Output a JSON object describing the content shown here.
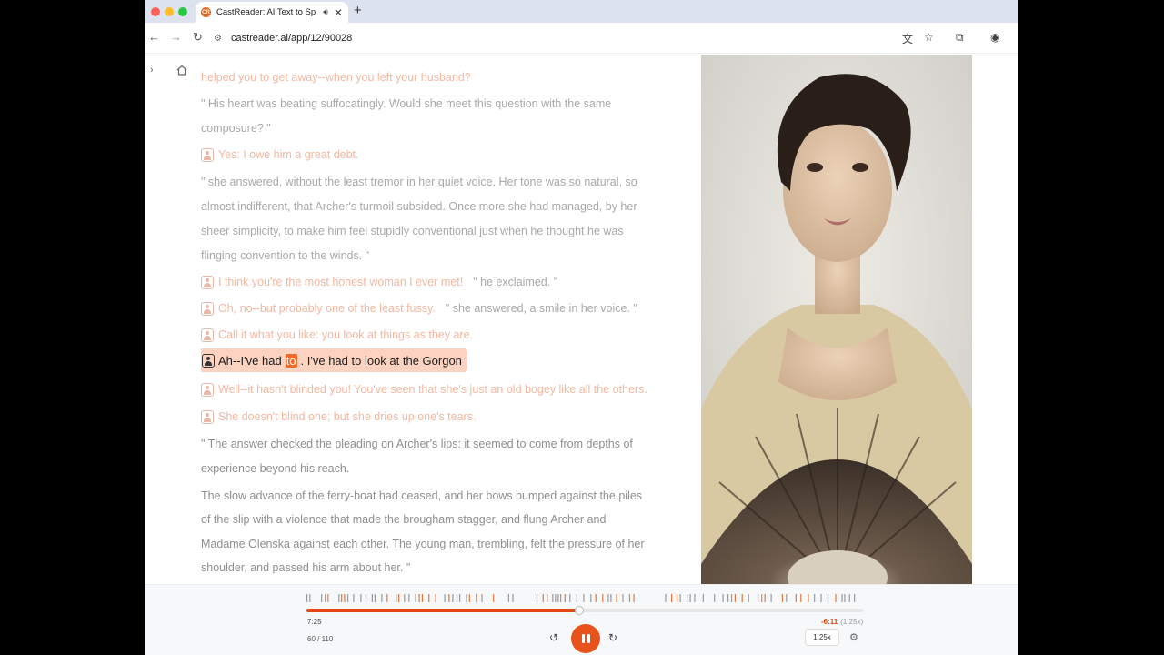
{
  "browser": {
    "tab_title": "CastReader: AI Text to Sp",
    "tab_favicon": "CR",
    "sound_icon": "speaker-icon",
    "close_glyph": "✕",
    "new_tab_glyph": "+",
    "url": "castreader.ai/app/12/90028"
  },
  "reader": {
    "lines": [
      {
        "text": "helped you to get away--when you left your husband?",
        "style": "faded"
      },
      {
        "text": "\" His heart was beating suffocatingly. Would she meet this question with the same",
        "style": "grey"
      },
      {
        "text": "composure? \"",
        "style": "grey"
      },
      {
        "text": "Yes: I owe him a great debt.",
        "style": "faded",
        "speaker": true
      },
      {
        "text": "\" she answered, without the least tremor in her quiet voice. Her tone was so natural, so",
        "style": "grey"
      },
      {
        "text": "almost indifferent, that Archer's turmoil subsided. Once more she had managed, by her",
        "style": "grey"
      },
      {
        "text": "sheer simplicity, to make him feel stupidly conventional just when he thought he was",
        "style": "grey"
      },
      {
        "text": "flinging convention to the winds. \"",
        "style": "grey"
      }
    ],
    "dialog": [
      {
        "quote": "I think you're the most honest woman I ever met!",
        "tail": "\" he exclaimed. \""
      },
      {
        "quote": "Oh, no--but probably one of the least fussy.",
        "tail": "\" she answered, a smile in her voice. \""
      },
      {
        "quote": "Call it what you like: you look at things as they are.",
        "tail": ""
      }
    ],
    "active_sentence": {
      "before": "Ah--I've had ",
      "word": "to",
      "after": ". I've had to look at the Gorgon"
    },
    "after_lines": [
      {
        "text": "Well--it hasn't blinded you! You've seen that she's just an old bogey like all the others.",
        "style": "faded",
        "speaker": true
      },
      {
        "text": "She doesn't blind one; but she dries up one's tears.",
        "style": "faded",
        "speaker": true
      },
      {
        "text": "\" The answer checked the pleading on Archer's lips: it seemed to come from depths of",
        "style": "dim"
      },
      {
        "text": "experience beyond his reach.",
        "style": "dim"
      },
      {
        "text": "The slow advance of the ferry-boat had ceased, and her bows bumped against the piles",
        "style": "dim"
      },
      {
        "text": "of the slip with a violence that made the brougham stagger, and flung Archer and",
        "style": "dim"
      },
      {
        "text": "Madame Olenska against each other. The young man, trembling, felt the pressure of her",
        "style": "dim"
      },
      {
        "text": "shoulder, and passed his arm about her. \"",
        "style": "dim"
      }
    ]
  },
  "player": {
    "elapsed": "7:25",
    "remaining": "-6:11",
    "rate_note": "(1.25x)",
    "progress_fraction": 0.49,
    "page": "60 / 110",
    "speed_label": "1.25x",
    "accent": "#e8531b"
  },
  "colors": {
    "accent": "#e8531b",
    "highlight_bg": "#fcd3c0",
    "highlight_word": "#f06a2a"
  }
}
